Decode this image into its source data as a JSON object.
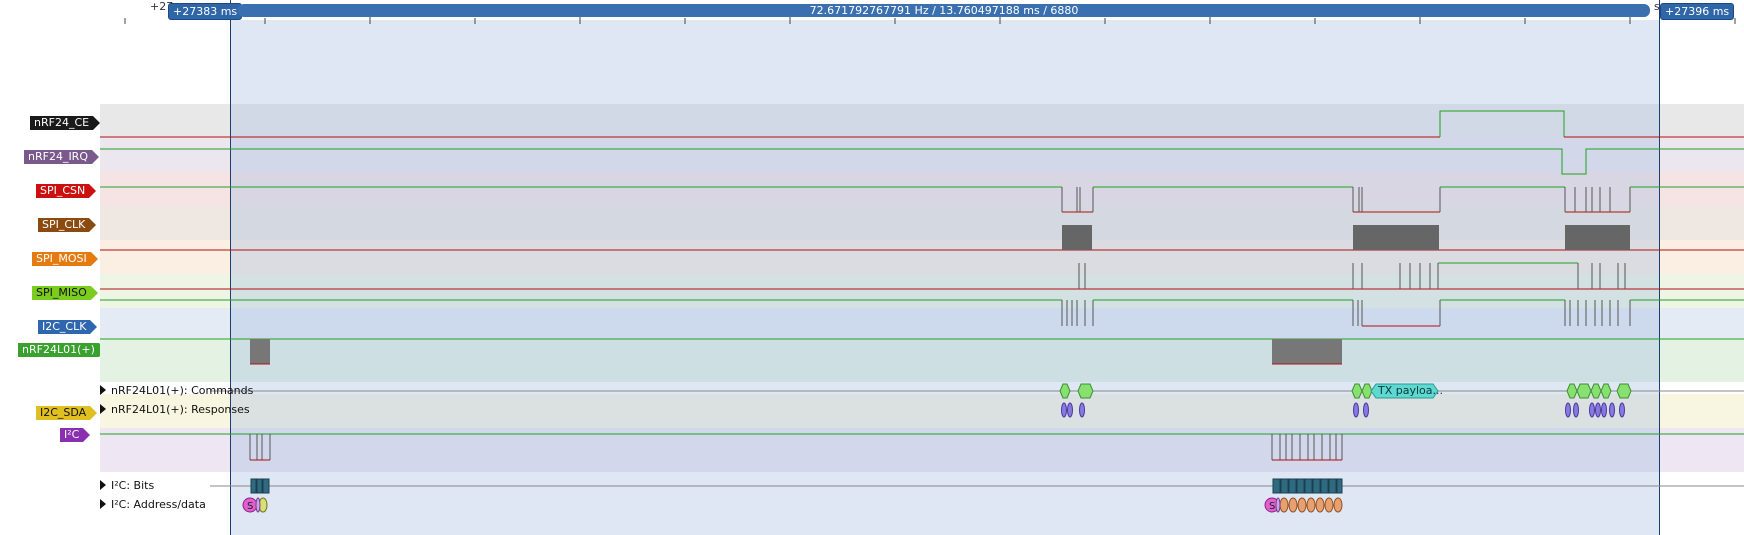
{
  "ruler": {
    "left_partial": "+27",
    "right_partial": "s",
    "marker_left": "+27383 ms",
    "marker_right": "+27396 ms",
    "measurement": "72.671792767791 Hz / 13.760497188 ms / 6880"
  },
  "channels": [
    {
      "id": "ce",
      "label": "nRF24_CE",
      "color": "#1a1a1a"
    },
    {
      "id": "irq",
      "label": "nRF24_IRQ",
      "color": "#7a5a8c"
    },
    {
      "id": "csn",
      "label": "SPI_CSN",
      "color": "#cc1010"
    },
    {
      "id": "clk",
      "label": "SPI_CLK",
      "color": "#8a4a10"
    },
    {
      "id": "mosi",
      "label": "SPI_MOSI",
      "color": "#e57a10"
    },
    {
      "id": "miso",
      "label": "SPI_MISO",
      "color": "#7ccc20"
    },
    {
      "id": "i2cclk",
      "label": "I2C_CLK",
      "color": "#2f66b0"
    },
    {
      "id": "nrf",
      "label": "nRF24L01(+)",
      "color": "#3aa030"
    },
    {
      "id": "sda",
      "label": "I2C_SDA",
      "color": "#e0c020"
    },
    {
      "id": "i2c",
      "label": "I²C",
      "color": "#8a2fb0"
    }
  ],
  "decoder_rows": {
    "nrf_commands": "nRF24L01(+): Commands",
    "nrf_responses": "nRF24L01(+): Responses",
    "i2c_bits": "I²C: Bits",
    "i2c_address": "I²C: Address/data"
  },
  "annotations": {
    "tx_payload": "TX payloa...",
    "start": "S"
  },
  "colors": {
    "high_trace": "#22a022",
    "low_trace": "#b01010",
    "selection": "#c8d8ec",
    "marker": "#2f66a8"
  }
}
